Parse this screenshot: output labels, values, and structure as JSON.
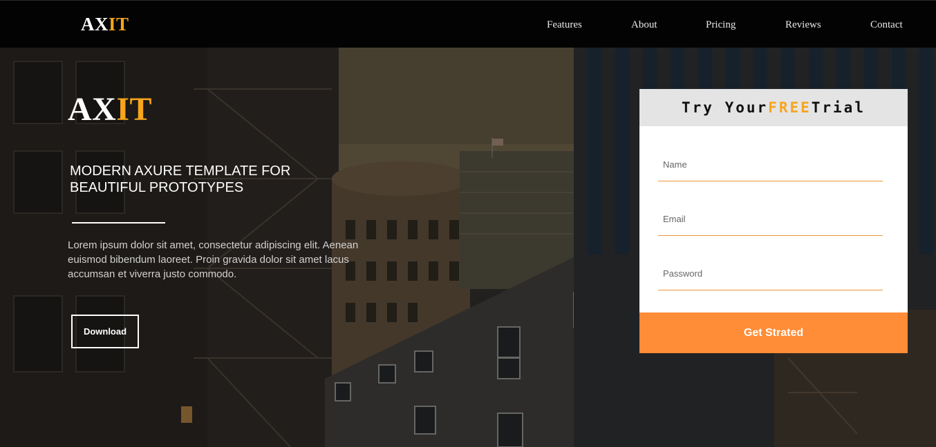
{
  "nav": {
    "logo": {
      "part1": "AX",
      "part2": "IT"
    },
    "links": [
      "Features",
      "About",
      "Pricing",
      "Reviews",
      "Contact"
    ]
  },
  "hero": {
    "logo": {
      "part1": "AX",
      "part2": "IT"
    },
    "title": "MODERN AXURE TEMPLATE FOR\nBEAUTIFUL PROTOTYPES",
    "body": "Lorem ipsum dolor sit amet, consectetur adipiscing elit. Aenean euismod bibendum laoreet. Proin gravida dolor sit amet lacus accumsan et viverra justo commodo.",
    "download_label": "Download"
  },
  "trial": {
    "title_before": "Try Your",
    "title_highlight": "FREE",
    "title_after": "Trial",
    "fields": {
      "name_placeholder": "Name",
      "email_placeholder": "Email",
      "password_placeholder": "Password"
    },
    "cta_label": "Get Strated"
  },
  "colors": {
    "accent": "#f7a51c",
    "cta": "#ff8c36",
    "navbar": "#030303",
    "field_underline": "#f0963a"
  },
  "background": {
    "description_icon": "city-buildings-photo"
  }
}
